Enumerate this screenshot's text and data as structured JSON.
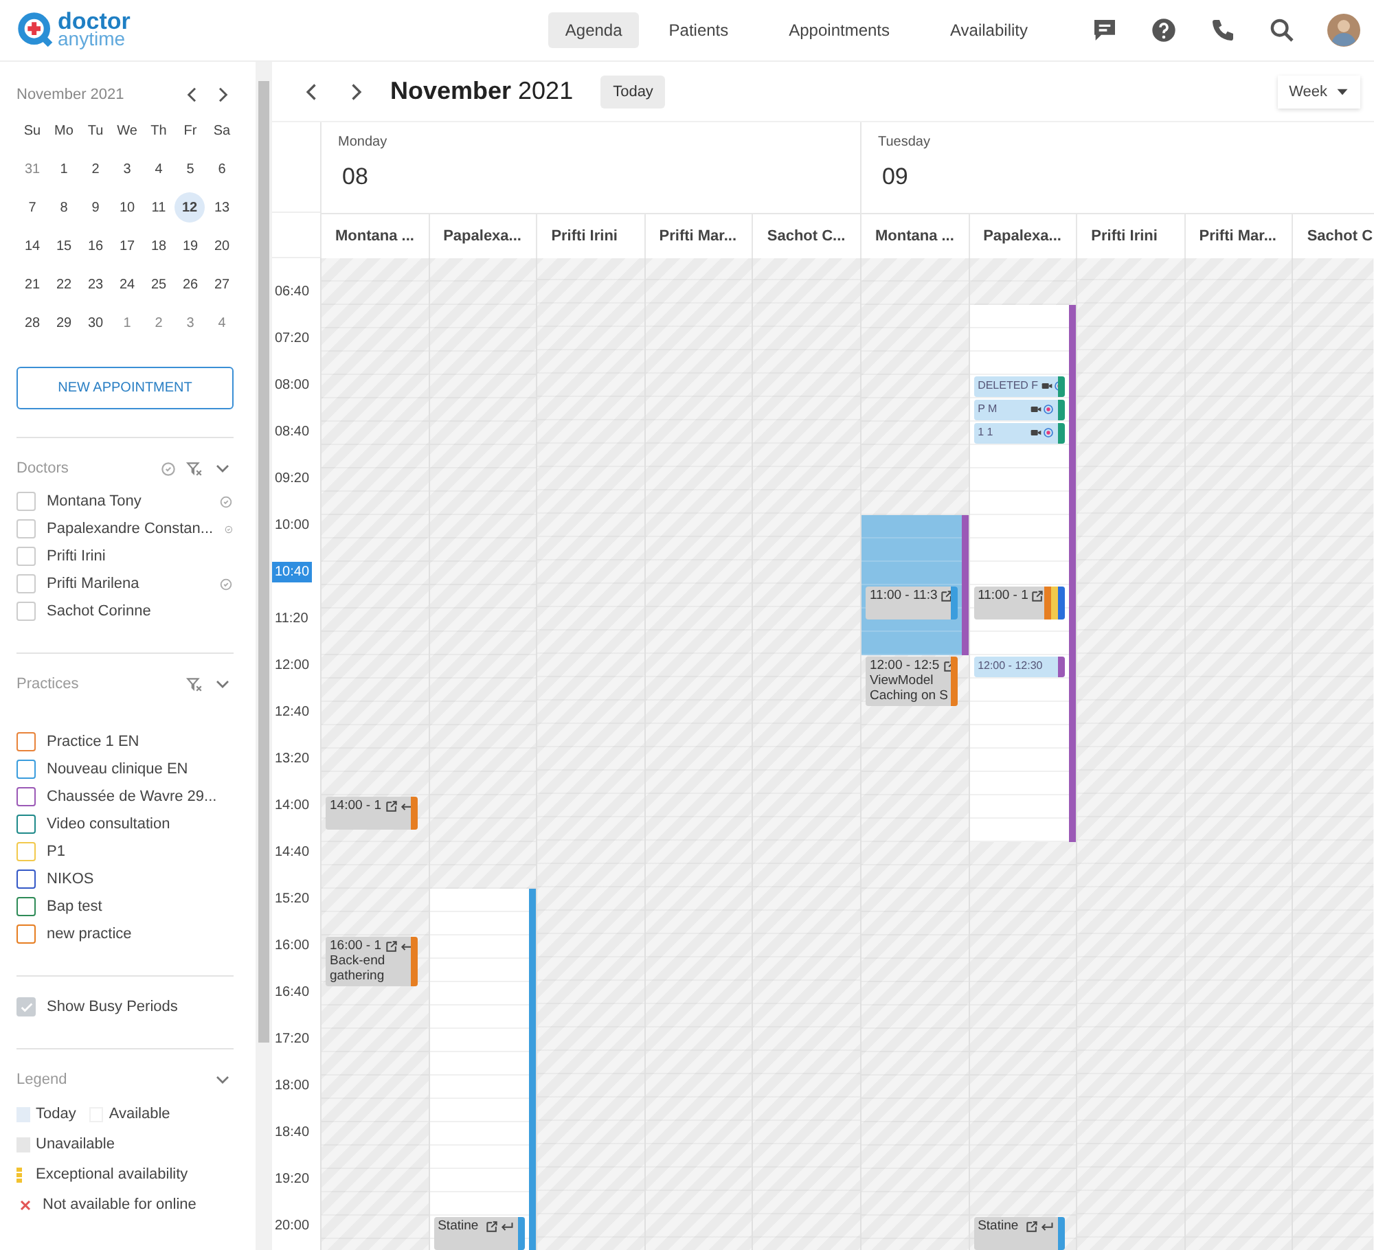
{
  "header": {
    "logo": {
      "line1": "doctor",
      "line2": "anytime"
    },
    "nav": [
      {
        "label": "Agenda",
        "selected": true
      },
      {
        "label": "Patients",
        "selected": false
      },
      {
        "label": "Appointments",
        "selected": false
      },
      {
        "label": "Availability",
        "selected": false
      }
    ]
  },
  "sidebar": {
    "mini_calendar": {
      "title": "November 2021",
      "weekdays": [
        "Su",
        "Mo",
        "Tu",
        "We",
        "Th",
        "Fr",
        "Sa"
      ],
      "weeks": [
        [
          {
            "day": "31",
            "muted": true,
            "selected": false
          },
          {
            "day": "1",
            "muted": false,
            "selected": false
          },
          {
            "day": "2",
            "muted": false,
            "selected": false
          },
          {
            "day": "3",
            "muted": false,
            "selected": false
          },
          {
            "day": "4",
            "muted": false,
            "selected": false
          },
          {
            "day": "5",
            "muted": false,
            "selected": false
          },
          {
            "day": "6",
            "muted": false,
            "selected": false
          }
        ],
        [
          {
            "day": "7",
            "muted": false,
            "selected": false
          },
          {
            "day": "8",
            "muted": false,
            "selected": false
          },
          {
            "day": "9",
            "muted": false,
            "selected": false
          },
          {
            "day": "10",
            "muted": false,
            "selected": false
          },
          {
            "day": "11",
            "muted": false,
            "selected": false
          },
          {
            "day": "12",
            "muted": false,
            "selected": true
          },
          {
            "day": "13",
            "muted": false,
            "selected": false
          }
        ],
        [
          {
            "day": "14",
            "muted": false,
            "selected": false
          },
          {
            "day": "15",
            "muted": false,
            "selected": false
          },
          {
            "day": "16",
            "muted": false,
            "selected": false
          },
          {
            "day": "17",
            "muted": false,
            "selected": false
          },
          {
            "day": "18",
            "muted": false,
            "selected": false
          },
          {
            "day": "19",
            "muted": false,
            "selected": false
          },
          {
            "day": "20",
            "muted": false,
            "selected": false
          }
        ],
        [
          {
            "day": "21",
            "muted": false,
            "selected": false
          },
          {
            "day": "22",
            "muted": false,
            "selected": false
          },
          {
            "day": "23",
            "muted": false,
            "selected": false
          },
          {
            "day": "24",
            "muted": false,
            "selected": false
          },
          {
            "day": "25",
            "muted": false,
            "selected": false
          },
          {
            "day": "26",
            "muted": false,
            "selected": false
          },
          {
            "day": "27",
            "muted": false,
            "selected": false
          }
        ],
        [
          {
            "day": "28",
            "muted": false,
            "selected": false
          },
          {
            "day": "29",
            "muted": false,
            "selected": false
          },
          {
            "day": "30",
            "muted": false,
            "selected": false
          },
          {
            "day": "1",
            "muted": true,
            "selected": false
          },
          {
            "day": "2",
            "muted": true,
            "selected": false
          },
          {
            "day": "3",
            "muted": true,
            "selected": false
          },
          {
            "day": "4",
            "muted": true,
            "selected": false
          }
        ]
      ]
    },
    "new_appointment": "NEW APPOINTMENT",
    "doctors": {
      "title": "Doctors",
      "items": [
        {
          "name": "Montana Tony",
          "checked": false,
          "synced": true
        },
        {
          "name": "Papalexandre Constan...",
          "checked": false,
          "synced": true
        },
        {
          "name": "Prifti Irini",
          "checked": false,
          "synced": false
        },
        {
          "name": "Prifti Marilena",
          "checked": false,
          "synced": true
        },
        {
          "name": "Sachot Corinne",
          "checked": false,
          "synced": false
        }
      ]
    },
    "practices": {
      "title": "Practices",
      "items": [
        {
          "name": "Practice 1 EN",
          "checked": false,
          "color": "#e8833a"
        },
        {
          "name": "Nouveau clinique EN",
          "checked": false,
          "color": "#3b9ddd"
        },
        {
          "name": "Chaussée de Wavre 29...",
          "checked": false,
          "color": "#9b59b6"
        },
        {
          "name": "Video consultation",
          "checked": false,
          "color": "#1f8a8a"
        },
        {
          "name": "P1",
          "checked": false,
          "color": "#f2c94c"
        },
        {
          "name": "NIKOS",
          "checked": false,
          "color": "#3559c7"
        },
        {
          "name": "Bap test",
          "checked": false,
          "color": "#2e8b57"
        },
        {
          "name": "new practice",
          "checked": false,
          "color": "#e67e22"
        }
      ]
    },
    "busy_toggle": {
      "label": "Show Busy Periods",
      "checked": true
    },
    "legend": {
      "title": "Legend",
      "rows": [
        [
          {
            "label": "Today",
            "kind": "today"
          },
          {
            "label": "Available",
            "kind": "available"
          }
        ],
        [
          {
            "label": "Unavailable",
            "kind": "unavailable"
          }
        ],
        [
          {
            "label": "Exceptional availability",
            "kind": "exceptional"
          }
        ],
        [
          {
            "label": "Not available for online",
            "kind": "not_online"
          }
        ]
      ]
    }
  },
  "calendar": {
    "title": "**November** 2021",
    "today_button": "Today",
    "view": "Week",
    "times": [
      {
        "label": "06:40",
        "current": false
      },
      {
        "label": "07:20",
        "current": false
      },
      {
        "label": "08:00",
        "current": false
      },
      {
        "label": "08:40",
        "current": false
      },
      {
        "label": "09:20",
        "current": false
      },
      {
        "label": "10:00",
        "current": false
      },
      {
        "label": "10:40",
        "current": true
      },
      {
        "label": "11:20",
        "current": false
      },
      {
        "label": "12:00",
        "current": false
      },
      {
        "label": "12:40",
        "current": false
      },
      {
        "label": "13:20",
        "current": false
      },
      {
        "label": "14:00",
        "current": false
      },
      {
        "label": "14:40",
        "current": false
      },
      {
        "label": "15:20",
        "current": false
      },
      {
        "label": "16:00",
        "current": false
      },
      {
        "label": "16:40",
        "current": false
      },
      {
        "label": "17:20",
        "current": false
      },
      {
        "label": "18:00",
        "current": false
      },
      {
        "label": "18:40",
        "current": false
      },
      {
        "label": "19:20",
        "current": false
      },
      {
        "label": "20:00",
        "current": false
      }
    ],
    "days": [
      {
        "weekday": "Monday",
        "date": "08",
        "resources": [
          {
            "name": "Montana ...",
            "segments": [
              {
                "kind": "unavailable",
                "slots": [
                  {
                    "kind": "slot"
                  },
                  {
                    "kind": "slot"
                  },
                  {
                    "kind": "slot"
                  },
                  {
                    "kind": "slot"
                  },
                  {
                    "kind": "slot"
                  },
                  {
                    "kind": "slot"
                  },
                  {
                    "kind": "slot"
                  },
                  {
                    "kind": "slot"
                  },
                  {
                    "kind": "slot"
                  },
                  {
                    "kind": "slot"
                  },
                  {
                    "kind": "slot"
                  },
                  {
                    "kind": "slot"
                  },
                  {
                    "kind": "slot"
                  },
                  {
                    "kind": "slot"
                  },
                  {
                    "kind": "slot"
                  },
                  {
                    "kind": "slot"
                  },
                  {
                    "kind": "slot"
                  },
                  {
                    "kind": "slot"
                  },
                  {
                    "kind": "slot"
                  },
                  {
                    "kind": "slot"
                  },
                  {
                    "kind": "slot"
                  },
                  {
                    "kind": "slot"
                  },
                  {
                    "kind": "slot"
                  },
                  {
                    "kind": "slot",
                    "events": [
                      {
                        "kind": "busy",
                        "lines": [
                          "14:00 - 1"
                        ],
                        "icons": [
                          {
                            "kind": "external"
                          },
                          {
                            "kind": "reply"
                          }
                        ],
                        "bars": [
                          {
                            "color": "#e67e22"
                          }
                        ]
                      }
                    ]
                  },
                  {
                    "kind": "slot"
                  },
                  {
                    "kind": "slot"
                  },
                  {
                    "kind": "slot"
                  },
                  {
                    "kind": "slot"
                  },
                  {
                    "kind": "slot"
                  },
                  {
                    "kind": "slot",
                    "events": [
                      {
                        "kind": "busy",
                        "lines": [
                          "16:00 - 1",
                          "Back-end",
                          "gathering"
                        ],
                        "icons": [
                          {
                            "kind": "external"
                          },
                          {
                            "kind": "reply"
                          }
                        ],
                        "bars": [
                          {
                            "color": "#e67e22"
                          }
                        ]
                      }
                    ]
                  },
                  {
                    "kind": "slot"
                  },
                  {
                    "kind": "slot"
                  },
                  {
                    "kind": "slot"
                  },
                  {
                    "kind": "slot"
                  },
                  {
                    "kind": "slot"
                  },
                  {
                    "kind": "slot"
                  },
                  {
                    "kind": "slot"
                  },
                  {
                    "kind": "slot"
                  },
                  {
                    "kind": "slot"
                  },
                  {
                    "kind": "slot"
                  },
                  {
                    "kind": "slot"
                  },
                  {
                    "kind": "slot"
                  },
                  {
                    "kind": "slot"
                  }
                ]
              }
            ]
          },
          {
            "name": "Papalexa...",
            "segments": [
              {
                "kind": "unavailable",
                "slots": [
                  {
                    "kind": "slot"
                  },
                  {
                    "kind": "slot"
                  },
                  {
                    "kind": "slot"
                  },
                  {
                    "kind": "slot"
                  },
                  {
                    "kind": "slot"
                  },
                  {
                    "kind": "slot"
                  },
                  {
                    "kind": "slot"
                  },
                  {
                    "kind": "slot"
                  },
                  {
                    "kind": "slot"
                  },
                  {
                    "kind": "slot"
                  },
                  {
                    "kind": "slot"
                  },
                  {
                    "kind": "slot"
                  },
                  {
                    "kind": "slot"
                  },
                  {
                    "kind": "slot"
                  },
                  {
                    "kind": "slot"
                  },
                  {
                    "kind": "slot"
                  },
                  {
                    "kind": "slot"
                  },
                  {
                    "kind": "slot"
                  },
                  {
                    "kind": "slot"
                  },
                  {
                    "kind": "slot"
                  },
                  {
                    "kind": "slot"
                  },
                  {
                    "kind": "slot"
                  },
                  {
                    "kind": "slot"
                  },
                  {
                    "kind": "slot"
                  },
                  {
                    "kind": "slot"
                  },
                  {
                    "kind": "slot"
                  },
                  {
                    "kind": "slot"
                  }
                ]
              },
              {
                "kind": "available",
                "color": "#3b9ddd",
                "slots": [
                  {
                    "kind": "slot"
                  },
                  {
                    "kind": "slot"
                  },
                  {
                    "kind": "slot"
                  },
                  {
                    "kind": "slot"
                  },
                  {
                    "kind": "slot"
                  },
                  {
                    "kind": "slot"
                  },
                  {
                    "kind": "slot"
                  },
                  {
                    "kind": "slot"
                  },
                  {
                    "kind": "slot"
                  },
                  {
                    "kind": "slot"
                  },
                  {
                    "kind": "slot"
                  },
                  {
                    "kind": "slot"
                  },
                  {
                    "kind": "slot"
                  },
                  {
                    "kind": "slot"
                  },
                  {
                    "kind": "slot",
                    "events": [
                      {
                        "kind": "busy",
                        "lines": [
                          "Statine"
                        ],
                        "icons": [
                          {
                            "kind": "external"
                          },
                          {
                            "kind": "reply"
                          }
                        ],
                        "bars": [
                          {
                            "color": "#3b9ddd"
                          }
                        ]
                      }
                    ]
                  },
                  {
                    "kind": "slot"
                  }
                ]
              }
            ]
          },
          {
            "name": "Prifti Irini"
          },
          {
            "name": "Prifti Mar..."
          },
          {
            "name": "Sachot C..."
          }
        ]
      },
      {
        "weekday": "Tuesday",
        "date": "09",
        "resources": [
          {
            "name": "Montana ...",
            "segments": [
              {
                "kind": "unavailable",
                "slots": [
                  {
                    "kind": "slot"
                  },
                  {
                    "kind": "slot"
                  },
                  {
                    "kind": "slot"
                  },
                  {
                    "kind": "slot"
                  },
                  {
                    "kind": "slot"
                  },
                  {
                    "kind": "slot"
                  },
                  {
                    "kind": "slot"
                  },
                  {
                    "kind": "slot"
                  },
                  {
                    "kind": "slot"
                  },
                  {
                    "kind": "slot"
                  },
                  {
                    "kind": "slot"
                  }
                ]
              },
              {
                "kind": "highlight",
                "color": "#9b59b6",
                "slots": [
                  {
                    "kind": "slot"
                  },
                  {
                    "kind": "slot"
                  },
                  {
                    "kind": "slot"
                  },
                  {
                    "kind": "slot",
                    "events": [
                      {
                        "kind": "busy",
                        "lines": [
                          "11:00 - 11:3"
                        ],
                        "icons": [
                          {
                            "kind": "external"
                          }
                        ],
                        "bars": [
                          {
                            "color": "#3b9ddd"
                          }
                        ]
                      }
                    ]
                  },
                  {
                    "kind": "slot"
                  },
                  {
                    "kind": "slot"
                  }
                ]
              },
              {
                "kind": "unavailable",
                "slots": [
                  {
                    "kind": "slot",
                    "events": [
                      {
                        "kind": "busy",
                        "lines": [
                          "12:00 - 12:5",
                          "ViewModel",
                          "Caching on S"
                        ],
                        "icons": [
                          {
                            "kind": "external"
                          }
                        ],
                        "bars": [
                          {
                            "color": "#e67e22"
                          }
                        ]
                      }
                    ]
                  },
                  {
                    "kind": "slot"
                  },
                  {
                    "kind": "slot"
                  },
                  {
                    "kind": "slot"
                  },
                  {
                    "kind": "slot"
                  },
                  {
                    "kind": "slot"
                  },
                  {
                    "kind": "slot"
                  },
                  {
                    "kind": "slot"
                  },
                  {
                    "kind": "slot"
                  },
                  {
                    "kind": "slot"
                  },
                  {
                    "kind": "slot"
                  },
                  {
                    "kind": "slot"
                  },
                  {
                    "kind": "slot"
                  },
                  {
                    "kind": "slot"
                  },
                  {
                    "kind": "slot"
                  },
                  {
                    "kind": "slot"
                  },
                  {
                    "kind": "slot"
                  },
                  {
                    "kind": "slot"
                  },
                  {
                    "kind": "slot"
                  },
                  {
                    "kind": "slot"
                  },
                  {
                    "kind": "slot"
                  },
                  {
                    "kind": "slot"
                  },
                  {
                    "kind": "slot"
                  },
                  {
                    "kind": "slot"
                  },
                  {
                    "kind": "slot"
                  },
                  {
                    "kind": "slot"
                  }
                ]
              }
            ]
          },
          {
            "name": "Papalexa...",
            "segments": [
              {
                "kind": "unavailable",
                "slots": [
                  {
                    "kind": "slot"
                  },
                  {
                    "kind": "slot"
                  }
                ]
              },
              {
                "kind": "available",
                "color": "#9b59b6",
                "slots": [
                  {
                    "kind": "slot"
                  },
                  {
                    "kind": "slot"
                  },
                  {
                    "kind": "slot"
                  },
                  {
                    "kind": "slot",
                    "events": [
                      {
                        "kind": "online",
                        "lines": [
                          "DELETED F"
                        ],
                        "icons": [
                          {
                            "kind": "video"
                          },
                          {
                            "kind": "target"
                          }
                        ],
                        "bars": [
                          {
                            "color": "#1f9d7a"
                          }
                        ]
                      }
                    ]
                  },
                  {
                    "kind": "slot",
                    "events": [
                      {
                        "kind": "online",
                        "lines": [
                          "P M"
                        ],
                        "icons": [
                          {
                            "kind": "video"
                          },
                          {
                            "kind": "target"
                          }
                        ],
                        "bars": [
                          {
                            "color": "#1f9d7a"
                          }
                        ]
                      }
                    ]
                  },
                  {
                    "kind": "slot",
                    "events": [
                      {
                        "kind": "online",
                        "lines": [
                          "1 1"
                        ],
                        "icons": [
                          {
                            "kind": "video"
                          },
                          {
                            "kind": "target"
                          }
                        ],
                        "bars": [
                          {
                            "color": "#1f9d7a"
                          }
                        ]
                      }
                    ]
                  },
                  {
                    "kind": "slot"
                  },
                  {
                    "kind": "slot"
                  },
                  {
                    "kind": "slot"
                  },
                  {
                    "kind": "slot"
                  },
                  {
                    "kind": "slot"
                  },
                  {
                    "kind": "slot"
                  },
                  {
                    "kind": "slot",
                    "events": [
                      {
                        "kind": "busy",
                        "lines": [
                          "11:00 - 1"
                        ],
                        "icons": [
                          {
                            "kind": "external"
                          }
                        ],
                        "bars": [
                          {
                            "color": "#e67e22"
                          },
                          {
                            "color": "#f2c94c"
                          },
                          {
                            "color": "#2a6fdb"
                          }
                        ]
                      }
                    ]
                  },
                  {
                    "kind": "slot"
                  },
                  {
                    "kind": "slot"
                  },
                  {
                    "kind": "slot",
                    "events": [
                      {
                        "kind": "online",
                        "lines": [
                          "12:00 - 12:30"
                        ],
                        "bars": [
                          {
                            "color": "#9b59b6"
                          }
                        ]
                      }
                    ]
                  },
                  {
                    "kind": "slot"
                  },
                  {
                    "kind": "slot"
                  },
                  {
                    "kind": "slot"
                  },
                  {
                    "kind": "slot"
                  },
                  {
                    "kind": "slot"
                  },
                  {
                    "kind": "slot"
                  },
                  {
                    "kind": "slot"
                  }
                ]
              },
              {
                "kind": "unavailable",
                "slots": [
                  {
                    "kind": "slot"
                  },
                  {
                    "kind": "slot"
                  },
                  {
                    "kind": "slot"
                  },
                  {
                    "kind": "slot"
                  },
                  {
                    "kind": "slot"
                  },
                  {
                    "kind": "slot"
                  },
                  {
                    "kind": "slot"
                  },
                  {
                    "kind": "slot"
                  },
                  {
                    "kind": "slot"
                  },
                  {
                    "kind": "slot"
                  },
                  {
                    "kind": "slot"
                  },
                  {
                    "kind": "slot"
                  },
                  {
                    "kind": "slot"
                  },
                  {
                    "kind": "slot"
                  },
                  {
                    "kind": "slot"
                  },
                  {
                    "kind": "slot"
                  },
                  {
                    "kind": "slot",
                    "events": [
                      {
                        "kind": "busy",
                        "lines": [
                          "Statine"
                        ],
                        "icons": [
                          {
                            "kind": "external"
                          },
                          {
                            "kind": "reply"
                          }
                        ],
                        "bars": [
                          {
                            "color": "#3b9ddd"
                          }
                        ]
                      }
                    ]
                  },
                  {
                    "kind": "slot"
                  }
                ]
              }
            ]
          },
          {
            "name": "Prifti Irini"
          },
          {
            "name": "Prifti Mar..."
          },
          {
            "name": "Sachot C"
          }
        ]
      }
    ]
  }
}
